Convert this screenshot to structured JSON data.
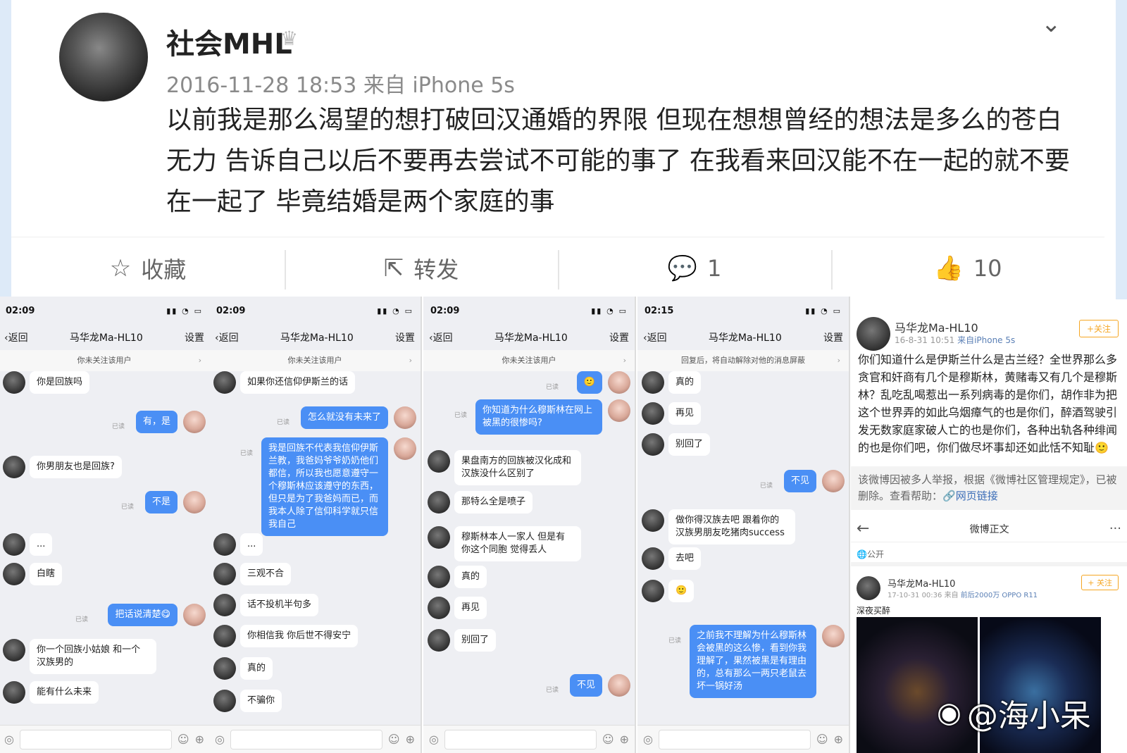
{
  "post": {
    "username": "社会MHL",
    "crown_icon": "♛",
    "meta": "2016-11-28 18:53 来自 iPhone 5s",
    "text": "以前我是那么渴望的想打破回汉通婚的界限 但现在想想曾经的想法是多么的苍白无力 告诉自己以后不要再去尝试不可能的事了 在我看来回汉能不在一起的就不要在一起了 毕竟结婚是两个家庭的事",
    "actions": {
      "favorite": "收藏",
      "repost": "转发",
      "comment_count": "1",
      "like_count": "10"
    }
  },
  "chat": {
    "back": "返回",
    "title": "马华龙Ma-HL10",
    "settings": "设置",
    "read": "已读",
    "panels": [
      {
        "time": "02:09",
        "notice": "你未关注该用户",
        "messages": [
          {
            "side": "l",
            "text": "你是回族吗"
          },
          {
            "side": "r",
            "text": "有，是"
          },
          {
            "side": "l",
            "text": "你男朋友也是回族?"
          },
          {
            "side": "r",
            "text": "不是"
          },
          {
            "side": "l",
            "text": "..."
          },
          {
            "side": "l",
            "text": "白瞎"
          },
          {
            "side": "r",
            "text": "把话说清楚😋"
          },
          {
            "side": "l",
            "text": "你一个回族小姑娘 和一个汉族男的"
          },
          {
            "side": "l",
            "text": "能有什么未来"
          }
        ]
      },
      {
        "time": "02:09",
        "notice": "你未关注该用户",
        "messages": [
          {
            "side": "l",
            "text": "如果你还信仰伊斯兰的话"
          },
          {
            "side": "r",
            "text": "怎么就没有未来了"
          },
          {
            "side": "r",
            "text": "我是回族不代表我信仰伊斯兰教，我爸妈爷爷奶奶他们都信，所以我也愿意遵守一个穆斯林应该遵守的东西，但只是为了我爸妈而已，而我本人除了信仰科学就只信我自己"
          },
          {
            "side": "l",
            "text": "..."
          },
          {
            "side": "l",
            "text": "三观不合"
          },
          {
            "side": "l",
            "text": "话不投机半句多"
          },
          {
            "side": "l",
            "text": "你相信我 你后世不得安宁"
          },
          {
            "side": "l",
            "text": "真的"
          },
          {
            "side": "l",
            "text": "不骗你"
          }
        ]
      },
      {
        "time": "02:09",
        "notice": "你未关注该用户",
        "messages": [
          {
            "side": "r",
            "text": "🙂"
          },
          {
            "side": "r",
            "text": "你知道为什么穆斯林在网上被黑的很惨吗?"
          },
          {
            "side": "l",
            "text": "果盘南方的回族被汉化成和汉族没什么区别了"
          },
          {
            "side": "l",
            "text": "那特么全是喷子"
          },
          {
            "side": "l",
            "text": "穆斯林本人一家人 但是有你这个同胞 觉得丢人"
          },
          {
            "side": "l",
            "text": "真的"
          },
          {
            "side": "l",
            "text": "再见"
          },
          {
            "side": "l",
            "text": "别回了"
          },
          {
            "side": "r",
            "text": "不见"
          }
        ]
      },
      {
        "time": "02:15",
        "notice": "回复后，将自动解除对他的消息屏蔽",
        "messages": [
          {
            "side": "l",
            "text": "真的"
          },
          {
            "side": "l",
            "text": "再见"
          },
          {
            "side": "l",
            "text": "别回了"
          },
          {
            "side": "r",
            "text": "不见"
          },
          {
            "side": "l",
            "text": "做你得汉族去吧 跟着你的汉族男朋友吃猪肉success"
          },
          {
            "side": "l",
            "text": "去吧"
          },
          {
            "side": "l",
            "text": "🙂"
          },
          {
            "side": "r",
            "text": "之前我不理解为什么穆斯林会被黑的这么惨，看到你我理解了，果然被黑是有理由的，总有那么一两只老鼠去坏一锅好汤"
          }
        ]
      }
    ]
  },
  "weibo": {
    "name": "马华龙Ma-HL10",
    "meta_time": "16-8-31 10:51",
    "meta_src": "来自iPhone 5s",
    "follow": "+关注",
    "text": "你们知道什么是伊斯兰什么是古兰经？全世界那么多贪官和奸商有几个是穆斯林，黄赌毒又有几个是穆斯林？乱吃乱喝惹出一系列病毒的是你们，胡作非为把这个世界弄的如此乌烟瘴气的也是你们，醉酒驾驶引发无数家庭家破人亡的也是你们，各种出轨各种绯闻的也是你们吧，你们做尽坏事却还如此恬不知耻🙂",
    "deleted": "该微博因被多人举报，根据《微博社区管理规定》，已被删除。查看帮助：",
    "link": "网页链接",
    "nav_title": "微博正文",
    "public": "公开",
    "name2": "马华龙Ma-HL10",
    "meta2_time": "17-10-31 00:36",
    "meta2_src": "来自",
    "meta2_dev": "前后2000万 OPPO R11",
    "follow2": "+ 关注",
    "text2": "深夜买醉"
  },
  "watermark": "@海小呆"
}
